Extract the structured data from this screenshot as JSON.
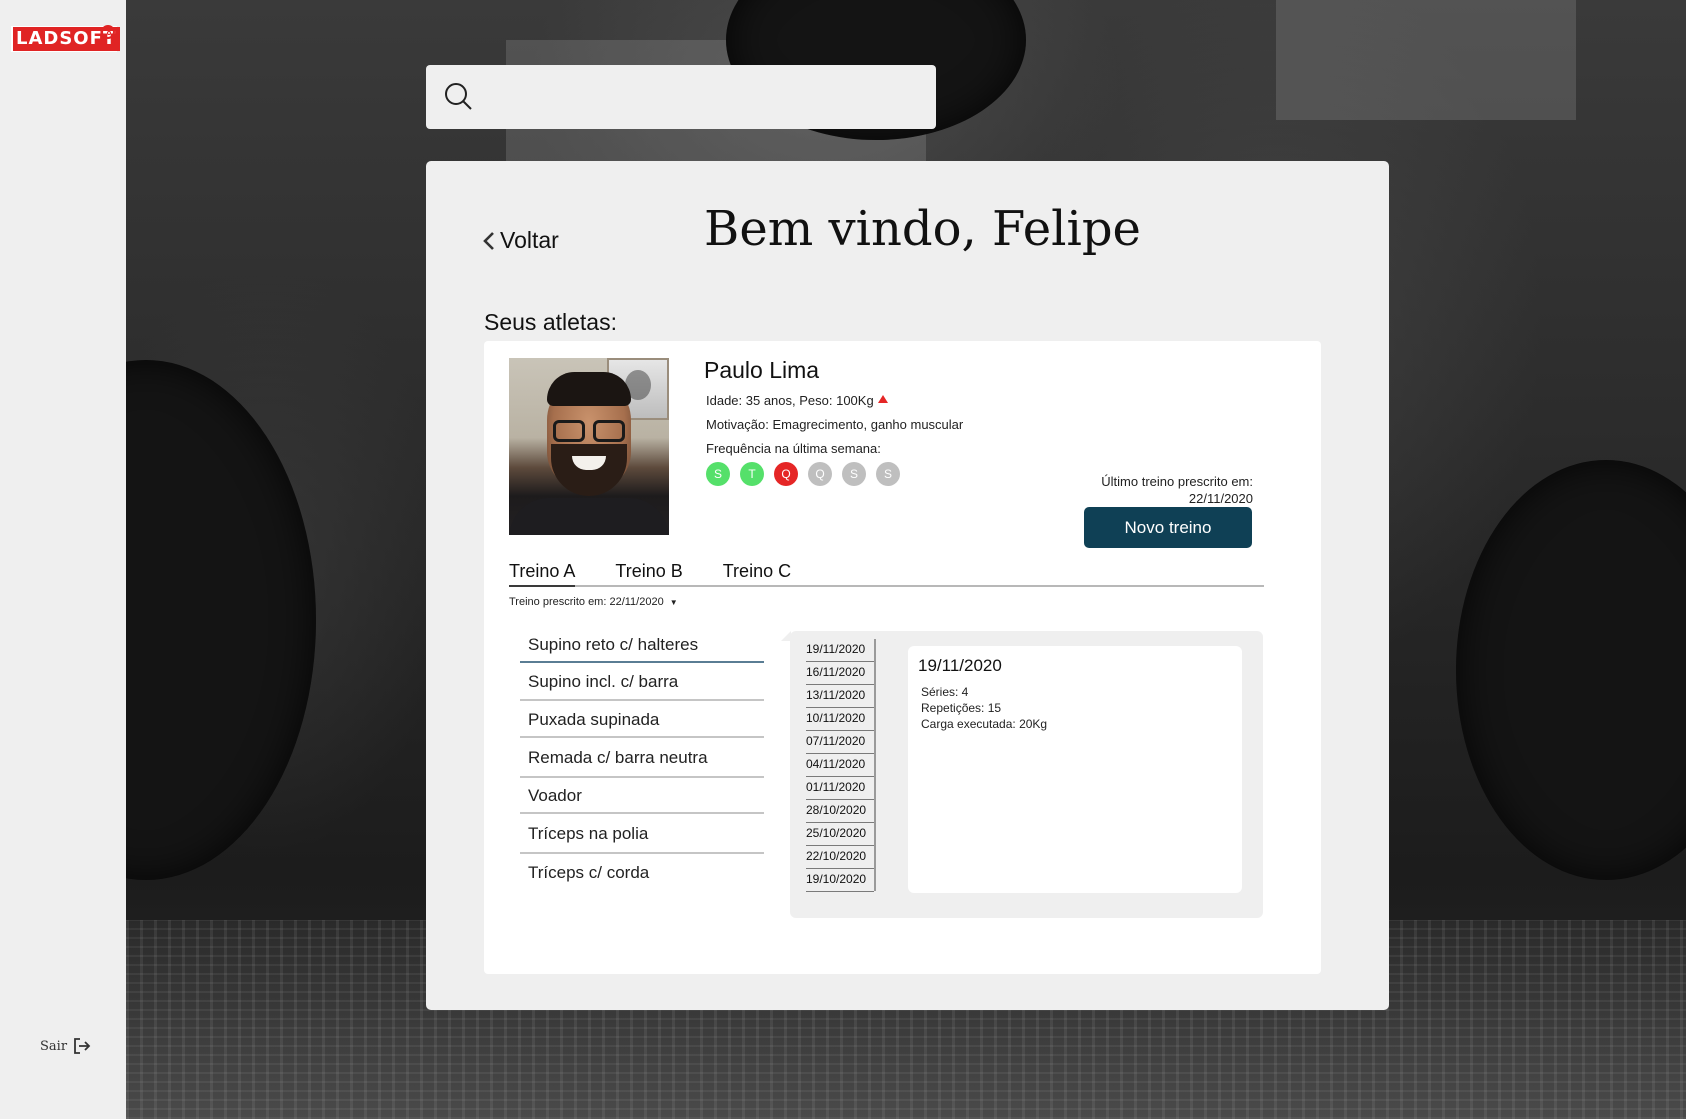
{
  "sidebar": {
    "logo_text": "LADSOFT",
    "logout_label": "Sair"
  },
  "search": {
    "placeholder": "",
    "value": ""
  },
  "header": {
    "back_label": "Voltar",
    "welcome": "Bem vindo, Felipe",
    "athletes_title": "Seus atletas:"
  },
  "athlete": {
    "name": "Paulo Lima",
    "age_weight": "Idade: 35 anos, Peso: 100Kg",
    "motivation": "Motivação: Emagrecimento, ganho muscular",
    "frequency_label": "Frequência na última semana:",
    "days": [
      {
        "letter": "S",
        "color": "#55e06a"
      },
      {
        "letter": "T",
        "color": "#55e06a"
      },
      {
        "letter": "Q",
        "color": "#e52626"
      },
      {
        "letter": "Q",
        "color": "#bfbfbf"
      },
      {
        "letter": "S",
        "color": "#bfbfbf"
      },
      {
        "letter": "S",
        "color": "#bfbfbf"
      }
    ],
    "last_prescribed_label": "Último treino prescrito em:",
    "last_prescribed_date": "22/11/2020",
    "new_button": "Novo treino"
  },
  "tabs": [
    "Treino A",
    "Treino B",
    "Treino C"
  ],
  "prescribed_select": "Treino prescrito em: 22/11/2020",
  "exercises": [
    "Supino reto c/ halteres",
    "Supino incl. c/ barra",
    "Puxada supinada",
    "Remada c/ barra neutra",
    "Voador",
    "Tríceps na polia",
    "Tríceps c/ corda"
  ],
  "history_dates": [
    "19/11/2020",
    "16/11/2020",
    "13/11/2020",
    "10/11/2020",
    "07/11/2020",
    "04/11/2020",
    "01/11/2020",
    "28/10/2020",
    "25/10/2020",
    "22/10/2020",
    "19/10/2020"
  ],
  "detail": {
    "date": "19/11/2020",
    "series": "Séries: 4",
    "reps": "Repetições: 15",
    "load": "Carga executada: 20Kg"
  },
  "colors": {
    "primary_button": "#0f4055",
    "brand_red": "#e02424",
    "present": "#55e06a",
    "missed": "#e52626",
    "future": "#bfbfbf"
  }
}
